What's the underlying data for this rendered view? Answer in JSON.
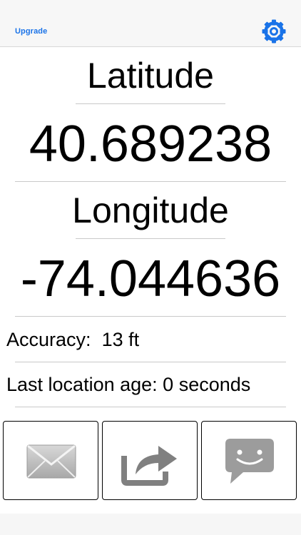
{
  "navbar": {
    "upgrade_label": "Upgrade",
    "settings_icon": "gear-icon",
    "accent_color": "#1a73e8"
  },
  "coordinates": {
    "latitude_label": "Latitude",
    "latitude_value": "40.689238",
    "longitude_label": "Longitude",
    "longitude_value": "-74.044636"
  },
  "details": {
    "accuracy_label": "Accuracy:",
    "accuracy_value": "13 ft",
    "age_label": "Last location age:",
    "age_value": "0 seconds"
  },
  "actions": [
    {
      "icon": "mail-icon"
    },
    {
      "icon": "share-icon"
    },
    {
      "icon": "message-icon"
    }
  ]
}
